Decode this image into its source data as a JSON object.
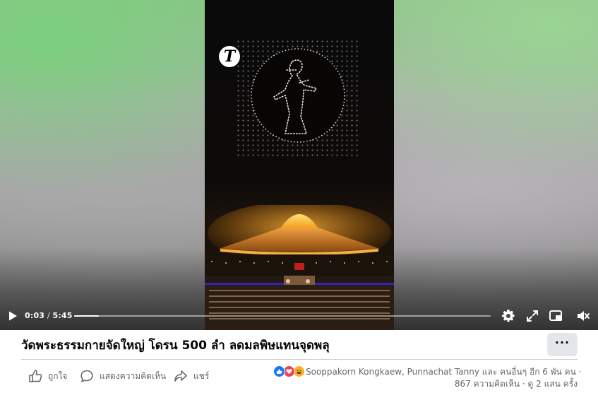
{
  "video": {
    "channel_logo_letter": "T",
    "current_time": "0:03",
    "separator": " / ",
    "duration": "5:45",
    "progress_fraction": 0.007
  },
  "post": {
    "title": "วัดพระธรรมกายจัดใหญ่ โดรน 500 ลำ ลดมลพิษแทนจุดพลุ",
    "more_label": "···"
  },
  "actions": {
    "like_label": "ถูกใจ",
    "comment_label": "แสดงความคิดเห็น",
    "share_label": "แชร์"
  },
  "engagement": {
    "reacted_by": "Sooppakorn Kongkaew, Punnachat Tanny และ คนอื่นๆ อีก 6 พัน คน ·",
    "comments_views": "867 ความคิดเห็น · ดู 2 แสน ครั้ง"
  },
  "colors": {
    "accent": "#1877f2",
    "love": "#f33e58",
    "haha": "#f7b125",
    "secondary_text": "#65676b"
  },
  "icons": [
    "play-icon",
    "settings-icon",
    "fullscreen-icon",
    "picture-in-picture-icon",
    "volume-muted-icon",
    "like-icon",
    "comment-icon",
    "share-icon"
  ]
}
